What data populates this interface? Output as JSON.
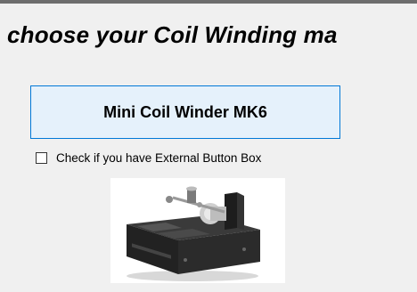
{
  "heading": "choose your Coil Winding ma",
  "machine_button": {
    "label": "Mini Coil Winder MK6"
  },
  "external_button_box": {
    "label": "Check if you have External Button Box",
    "checked": false
  },
  "machine_image": {
    "depicts": "coil-winder-machine"
  },
  "colors": {
    "window_bg": "#f0f0f0",
    "button_bg": "#e5f1fb",
    "button_border": "#0078d7",
    "machine_body": "#2b2b2b"
  }
}
